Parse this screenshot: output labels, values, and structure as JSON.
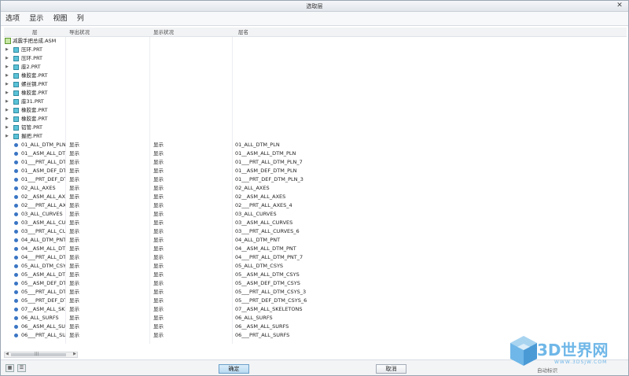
{
  "window": {
    "title": "选取层",
    "close_glyph": "✕"
  },
  "menu": [
    "选项",
    "显示",
    "视图",
    "列"
  ],
  "columns": {
    "layer": "层",
    "export": "导出状况",
    "display": "显示状况",
    "layer_name": "层名"
  },
  "top_item": "减震手把总成.ASM",
  "parts": [
    "压环.PRT",
    "压环.PRT",
    "座2.PRT",
    "橡胶套.PRT",
    "螺丝钢.PRT",
    "橡胶套.PRT",
    "座31.PRT",
    "橡胶套.PRT",
    "橡胶套.PRT",
    "铝管.PRT",
    "握把.PRT"
  ],
  "layers": [
    {
      "name": "01_ALL_DTM_PLN",
      "export": "显示",
      "display": "显示",
      "layer_name": "01_ALL_DTM_PLN"
    },
    {
      "name": "01__ASM_ALL_DT",
      "export": "显示",
      "display": "显示",
      "layer_name": "01__ASM_ALL_DTM_PLN"
    },
    {
      "name": "01___PRT_ALL_DT",
      "export": "显示",
      "display": "显示",
      "layer_name": "01___PRT_ALL_DTM_PLN_7"
    },
    {
      "name": "01__ASM_DEF_DT",
      "export": "显示",
      "display": "显示",
      "layer_name": "01__ASM_DEF_DTM_PLN"
    },
    {
      "name": "01___PRT_DEF_DT",
      "export": "显示",
      "display": "显示",
      "layer_name": "01___PRT_DEF_DTM_PLN_3"
    },
    {
      "name": "02_ALL_AXES",
      "export": "显示",
      "display": "显示",
      "layer_name": "02_ALL_AXES"
    },
    {
      "name": "02__ASM_ALL_AX",
      "export": "显示",
      "display": "显示",
      "layer_name": "02__ASM_ALL_AXES"
    },
    {
      "name": "02___PRT_ALL_AX",
      "export": "显示",
      "display": "显示",
      "layer_name": "02___PRT_ALL_AXES_4"
    },
    {
      "name": "03_ALL_CURVES",
      "export": "显示",
      "display": "显示",
      "layer_name": "03_ALL_CURVES"
    },
    {
      "name": "03__ASM_ALL_CU",
      "export": "显示",
      "display": "显示",
      "layer_name": "03__ASM_ALL_CURVES"
    },
    {
      "name": "03___PRT_ALL_CU",
      "export": "显示",
      "display": "显示",
      "layer_name": "03___PRT_ALL_CURVES_6"
    },
    {
      "name": "04_ALL_DTM_PNT",
      "export": "显示",
      "display": "显示",
      "layer_name": "04_ALL_DTM_PNT"
    },
    {
      "name": "04__ASM_ALL_DT",
      "export": "显示",
      "display": "显示",
      "layer_name": "04__ASM_ALL_DTM_PNT"
    },
    {
      "name": "04___PRT_ALL_DT",
      "export": "显示",
      "display": "显示",
      "layer_name": "04___PRT_ALL_DTM_PNT_7"
    },
    {
      "name": "05_ALL_DTM_CSY",
      "export": "显示",
      "display": "显示",
      "layer_name": "05_ALL_DTM_CSYS"
    },
    {
      "name": "05__ASM_ALL_DT",
      "export": "显示",
      "display": "显示",
      "layer_name": "05__ASM_ALL_DTM_CSYS"
    },
    {
      "name": "05__ASM_DEF_DT",
      "export": "显示",
      "display": "显示",
      "layer_name": "05__ASM_DEF_DTM_CSYS"
    },
    {
      "name": "05___PRT_ALL_DT",
      "export": "显示",
      "display": "显示",
      "layer_name": "05___PRT_ALL_DTM_CSYS_3"
    },
    {
      "name": "05___PRT_DEF_DT",
      "export": "显示",
      "display": "显示",
      "layer_name": "05___PRT_DEF_DTM_CSYS_6"
    },
    {
      "name": "07__ASM_ALL_SK",
      "export": "显示",
      "display": "显示",
      "layer_name": "07__ASM_ALL_SKELETONS"
    },
    {
      "name": "06_ALL_SURFS",
      "export": "显示",
      "display": "显示",
      "layer_name": "06_ALL_SURFS"
    },
    {
      "name": "06__ASM_ALL_SU",
      "export": "显示",
      "display": "显示",
      "layer_name": "06__ASM_ALL_SURFS"
    },
    {
      "name": "06___PRT_ALL_SU",
      "export": "显示",
      "display": "显示",
      "layer_name": "06___PRT_ALL_SURFS"
    }
  ],
  "buttons": {
    "ok": "确定",
    "cancel": "取消"
  },
  "scroll": {
    "left": "◀",
    "right": "▶",
    "grip": "|||"
  },
  "view_toggles": [
    "▦",
    "☰"
  ],
  "watermark": {
    "brand": "3D世界网",
    "url": "WWW.3DSJW.COM",
    "caption": "自动标识"
  },
  "colors": {
    "accent": "#3a75c4",
    "part_icon": "#5bc3d8",
    "asm_icon": "#c6e6a2"
  }
}
